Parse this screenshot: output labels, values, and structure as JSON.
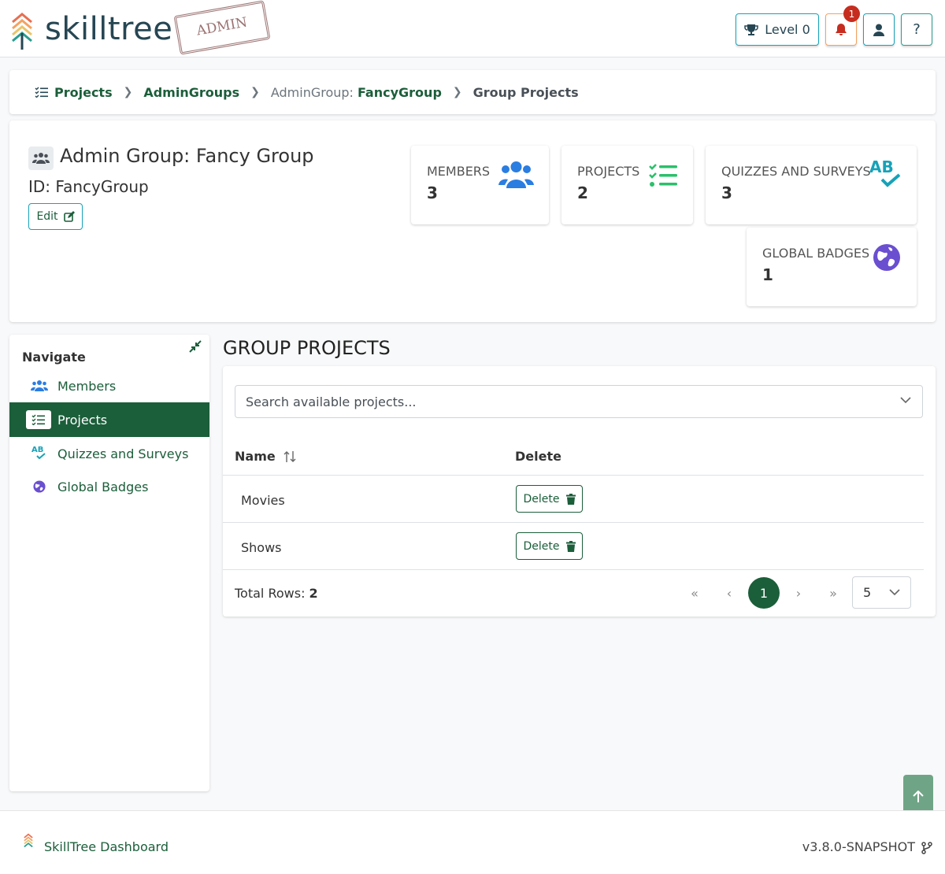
{
  "header": {
    "brand": "skilltree",
    "stamp": "ADMIN",
    "level_label": "Level 0",
    "notification_count": "1",
    "help_label": "?"
  },
  "breadcrumb": {
    "projects": "Projects",
    "admin_groups": "AdminGroups",
    "group_prefix": "AdminGroup:",
    "group_id": "FancyGroup",
    "current": "Group Projects"
  },
  "group": {
    "title": "Admin Group: Fancy Group",
    "id_line": "ID: FancyGroup",
    "edit_label": "Edit"
  },
  "stats": [
    {
      "label": "Members",
      "value": "3",
      "icon": "users-icon"
    },
    {
      "label": "Projects",
      "value": "2",
      "icon": "list-check-icon"
    },
    {
      "label": "Quizzes and Surveys",
      "value": "3",
      "icon": "spell-check-icon"
    },
    {
      "label": "Global Badges",
      "value": "1",
      "icon": "globe-icon"
    }
  ],
  "nav": {
    "title": "Navigate",
    "items": [
      {
        "label": "Members",
        "icon": "users-icon"
      },
      {
        "label": "Projects",
        "icon": "list-check-icon",
        "active": true
      },
      {
        "label": "Quizzes and Surveys",
        "icon": "spell-check-icon"
      },
      {
        "label": "Global Badges",
        "icon": "globe-icon"
      }
    ]
  },
  "main": {
    "title": "GROUP PROJECTS",
    "search_placeholder": "Search available projects...",
    "columns": [
      "Name",
      "Delete"
    ],
    "rows": [
      {
        "name": "Movies",
        "action": "Delete"
      },
      {
        "name": "Shows",
        "action": "Delete"
      }
    ],
    "total_label": "Total Rows:",
    "total_value": "2",
    "current_page": "1",
    "page_size": "5"
  },
  "footer": {
    "title": "SkillTree Dashboard",
    "version": "v3.8.0-SNAPSHOT"
  },
  "colors": {
    "primary": "#1b5e3a",
    "accent": "#17a2b8",
    "warning": "#f4a261",
    "danger": "#c62d1f",
    "stat_blue": "#2a7de1",
    "stat_green": "#2bc06b"
  }
}
